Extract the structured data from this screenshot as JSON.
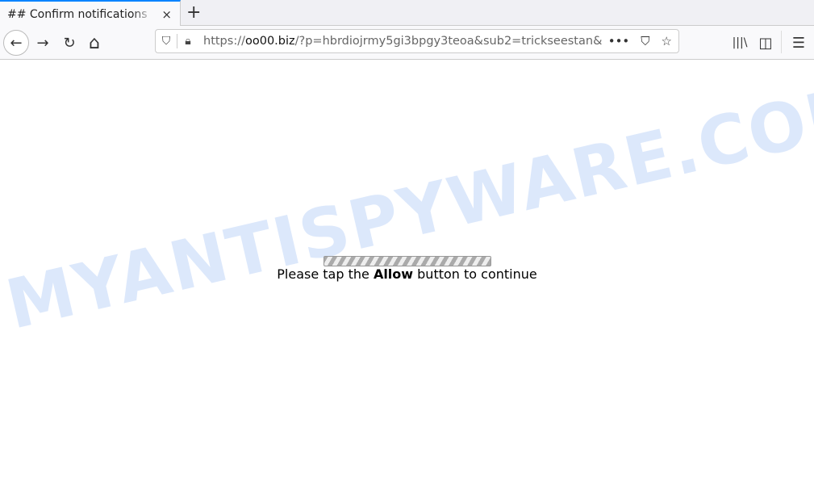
{
  "tab": {
    "title": "## Confirm notifications",
    "close": "×",
    "new_tab": "+"
  },
  "nav": {
    "back": "←",
    "forward": "→",
    "reload": "↻",
    "home": "⌂"
  },
  "url": {
    "prefix": "https://",
    "domain": "oo00.biz",
    "rest": "/?p=hbrdiojrmy5gi3bpgy3teoa&sub2=trickseestan&",
    "more": "•••",
    "pocket": "⛉",
    "star": "☆"
  },
  "toolbar": {
    "library": "|||\\",
    "sidebar": "◫",
    "menu": "☰"
  },
  "page": {
    "message_before": "Please tap the ",
    "message_bold": "Allow",
    "message_after": " button to continue",
    "progress_animated": true
  },
  "watermark": "MYANTISPYWARE.COM"
}
